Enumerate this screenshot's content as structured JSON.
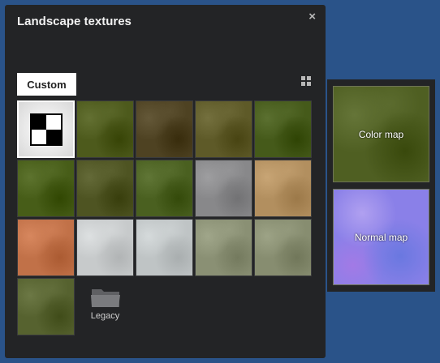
{
  "panel": {
    "title": "Landscape textures",
    "close_glyph": "×",
    "tab": "Custom",
    "view_icon": "grid-view-icon"
  },
  "tiles": [
    {
      "name": "checker",
      "color": "#e6e6e6"
    },
    {
      "name": "grass-1",
      "color": "#4d5a1c"
    },
    {
      "name": "grass-dirt",
      "color": "#4e4222"
    },
    {
      "name": "grass-dry",
      "color": "#5e5a28"
    },
    {
      "name": "grass-2",
      "color": "#455a1a"
    },
    {
      "name": "grass-3",
      "color": "#475d18"
    },
    {
      "name": "grass-4",
      "color": "#4e5422"
    },
    {
      "name": "grass-5",
      "color": "#4a6020"
    },
    {
      "name": "gravel",
      "color": "#88888a"
    },
    {
      "name": "sand",
      "color": "#b28f5f"
    },
    {
      "name": "clay",
      "color": "#c17148"
    },
    {
      "name": "snow-1",
      "color": "#c7cacb"
    },
    {
      "name": "snow-2",
      "color": "#bfc4c5"
    },
    {
      "name": "snow-grass-1",
      "color": "#8a9074"
    },
    {
      "name": "snow-grass-2",
      "color": "#878d70"
    },
    {
      "name": "snow-grass-3",
      "color": "#56622f"
    }
  ],
  "legacy": {
    "label": "Legacy",
    "icon": "folder-icon"
  },
  "maps": {
    "color": {
      "label": "Color map",
      "color": "#4f5f22"
    },
    "normal": {
      "label": "Normal map",
      "color": "#8a80e8"
    }
  }
}
